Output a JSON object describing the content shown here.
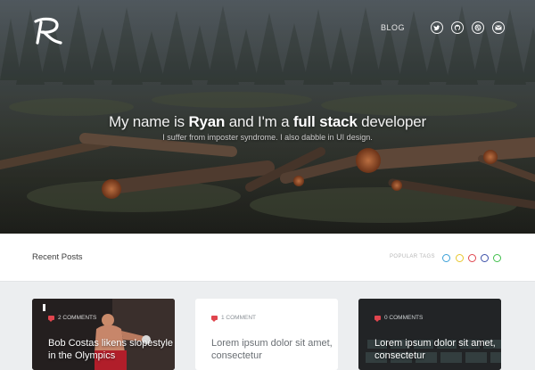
{
  "header": {
    "logo_letter": "R",
    "nav": {
      "blog_label": "BLOG"
    },
    "social_icons": [
      "twitter-icon",
      "github-icon",
      "dribbble-icon",
      "email-icon"
    ]
  },
  "hero": {
    "headline": {
      "part1": "My name is ",
      "name": "Ryan",
      "part2": " and I'm a ",
      "role": "full stack",
      "part3": " developer"
    },
    "subheading": "I suffer from imposter syndrome. I also dabble in UI design."
  },
  "recent": {
    "title": "Recent Posts",
    "popular_tags_label": "POPULAR TAGS",
    "tag_colors": [
      "#3aa0d8",
      "#e8c72b",
      "#e0454e",
      "#3b4fa8",
      "#3fbf4a"
    ]
  },
  "posts": [
    {
      "comments": "2 COMMENTS",
      "title": "Bob Costas likens slopestyle in the Olympics"
    },
    {
      "comments": "1 COMMENT",
      "title": "Lorem ipsum dolor sit amet, consectetur"
    },
    {
      "comments": "0 COMMENTS",
      "title": "Lorem ipsum dolor sit amet, consectetur"
    }
  ],
  "colors": {
    "accent": "#e0454e"
  }
}
